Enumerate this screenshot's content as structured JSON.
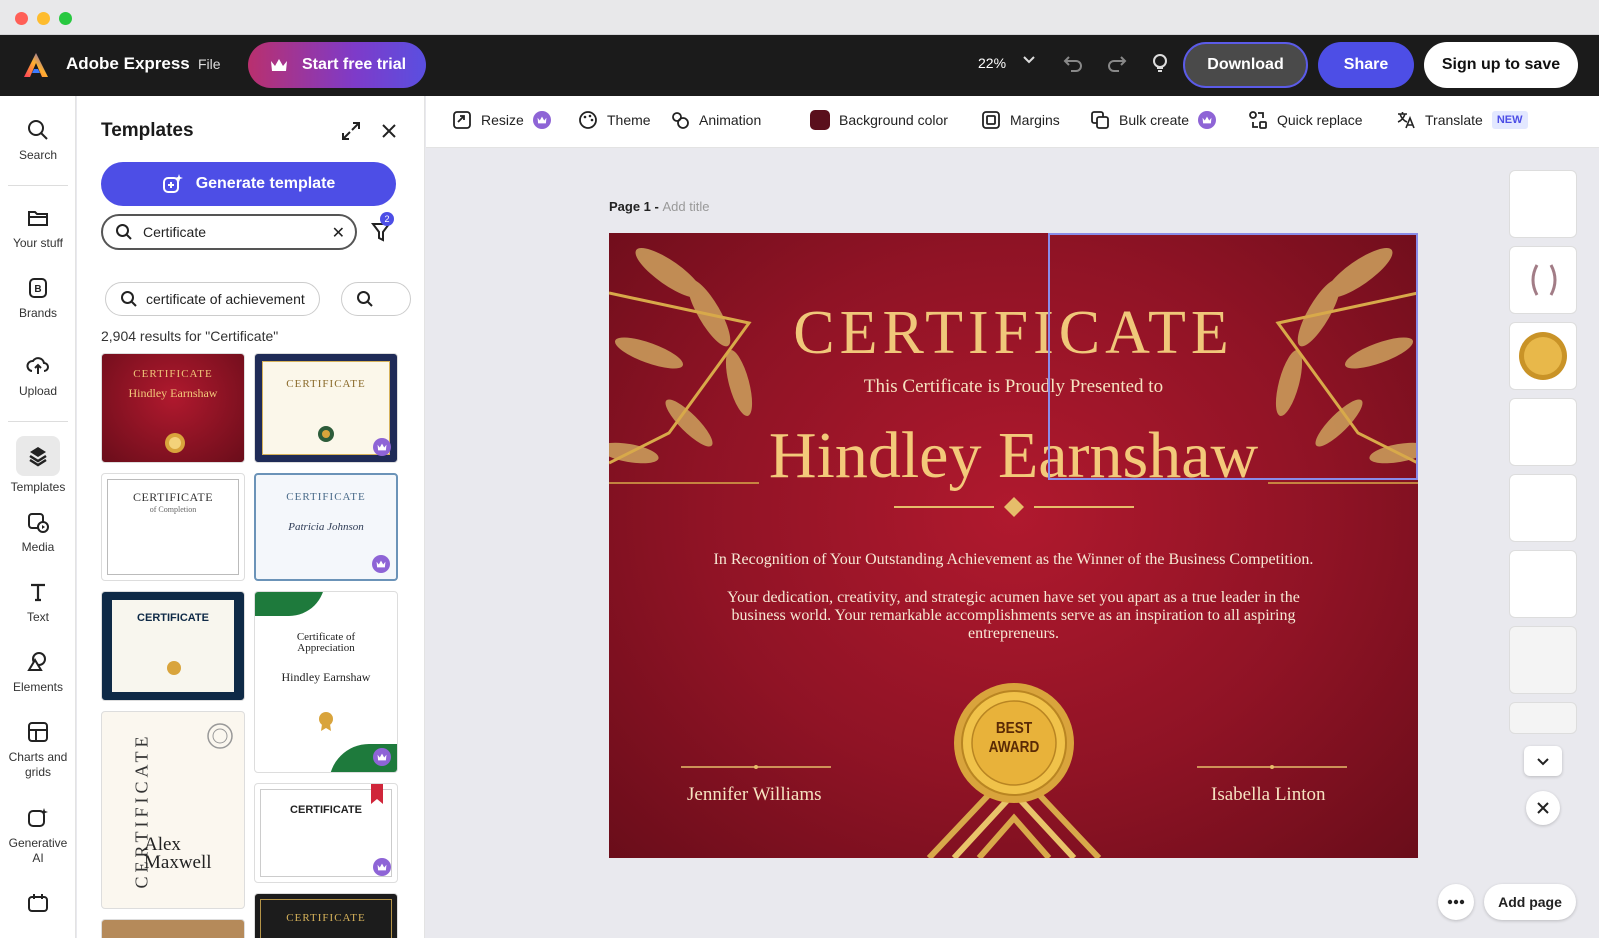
{
  "app": {
    "brand": "Adobe Express",
    "file_menu": "File",
    "trial_label": "Start free trial",
    "zoom": "22%",
    "download_label": "Download",
    "share_label": "Share",
    "signup_label": "Sign up to save"
  },
  "rail": {
    "items": [
      {
        "label": "Search",
        "icon": "search-icon"
      },
      {
        "label": "Your stuff",
        "icon": "folder-icon"
      },
      {
        "label": "Brands",
        "icon": "brand-icon"
      },
      {
        "label": "Upload",
        "icon": "upload-icon"
      },
      {
        "label": "Templates",
        "icon": "templates-icon"
      },
      {
        "label": "Media",
        "icon": "media-icon"
      },
      {
        "label": "Text",
        "icon": "text-icon"
      },
      {
        "label": "Elements",
        "icon": "elements-icon"
      },
      {
        "label": "Charts and grids",
        "icon": "charts-icon"
      },
      {
        "label": "Generative AI",
        "icon": "generative-ai-icon"
      }
    ]
  },
  "panel": {
    "title": "Templates",
    "generate_label": "Generate template",
    "search_value": "Certificate",
    "filter_count": "2",
    "chip_label": "certificate of achievement",
    "results_text": "2,904 results for \"Certificate\"",
    "thumbs": {
      "t1_title": "CERTIFICATE",
      "t1_name": "Hindley Earnshaw",
      "t2_title": "CERTIFICATE",
      "t3_title": "CERTIFICATE",
      "t3_sub": "of Completion",
      "t4_title": "CERTIFICATE",
      "t4_name": "Patricia Johnson",
      "t5_title": "CERTIFICATE",
      "t6_title": "Certificate of Appreciation",
      "t6_name": "Hindley Earnshaw",
      "t7_title": "CERTIFICATE",
      "t7_name": "Alex Maxwell",
      "t8_title": "CERTIFICATE",
      "t9_title": "CERTIFICATE"
    }
  },
  "context_bar": {
    "resize": "Resize",
    "theme": "Theme",
    "animation": "Animation",
    "background_color": "Background color",
    "background_swatch": "#5a0f1c",
    "margins": "Margins",
    "bulk_create": "Bulk create",
    "quick_replace": "Quick replace",
    "translate": "Translate",
    "new_badge": "NEW"
  },
  "canvas": {
    "page_label": "Page 1 - ",
    "add_title": "Add title",
    "certificate": {
      "title": "CERTIFICATE",
      "subtitle": "This Certificate is Proudly Presented to",
      "recipient": "Hindley Earnshaw",
      "recognition": "In Recognition of Your Outstanding Achievement as the Winner of the Business Competition.",
      "body": "Your dedication, creativity, and strategic acumen have set you apart as a true leader in the business world. Your remarkable accomplishments serve as an inspiration to all aspiring entrepreneurs.",
      "seal_line1": "BEST",
      "seal_line2": "AWARD",
      "signer_left": "Jennifer Williams",
      "signer_right": "Isabella Linton"
    }
  },
  "add_page_label": "Add page",
  "colors": {
    "accent": "#4d4ee6",
    "cert_red": "#9b1428",
    "gold": "#f0c77a"
  }
}
